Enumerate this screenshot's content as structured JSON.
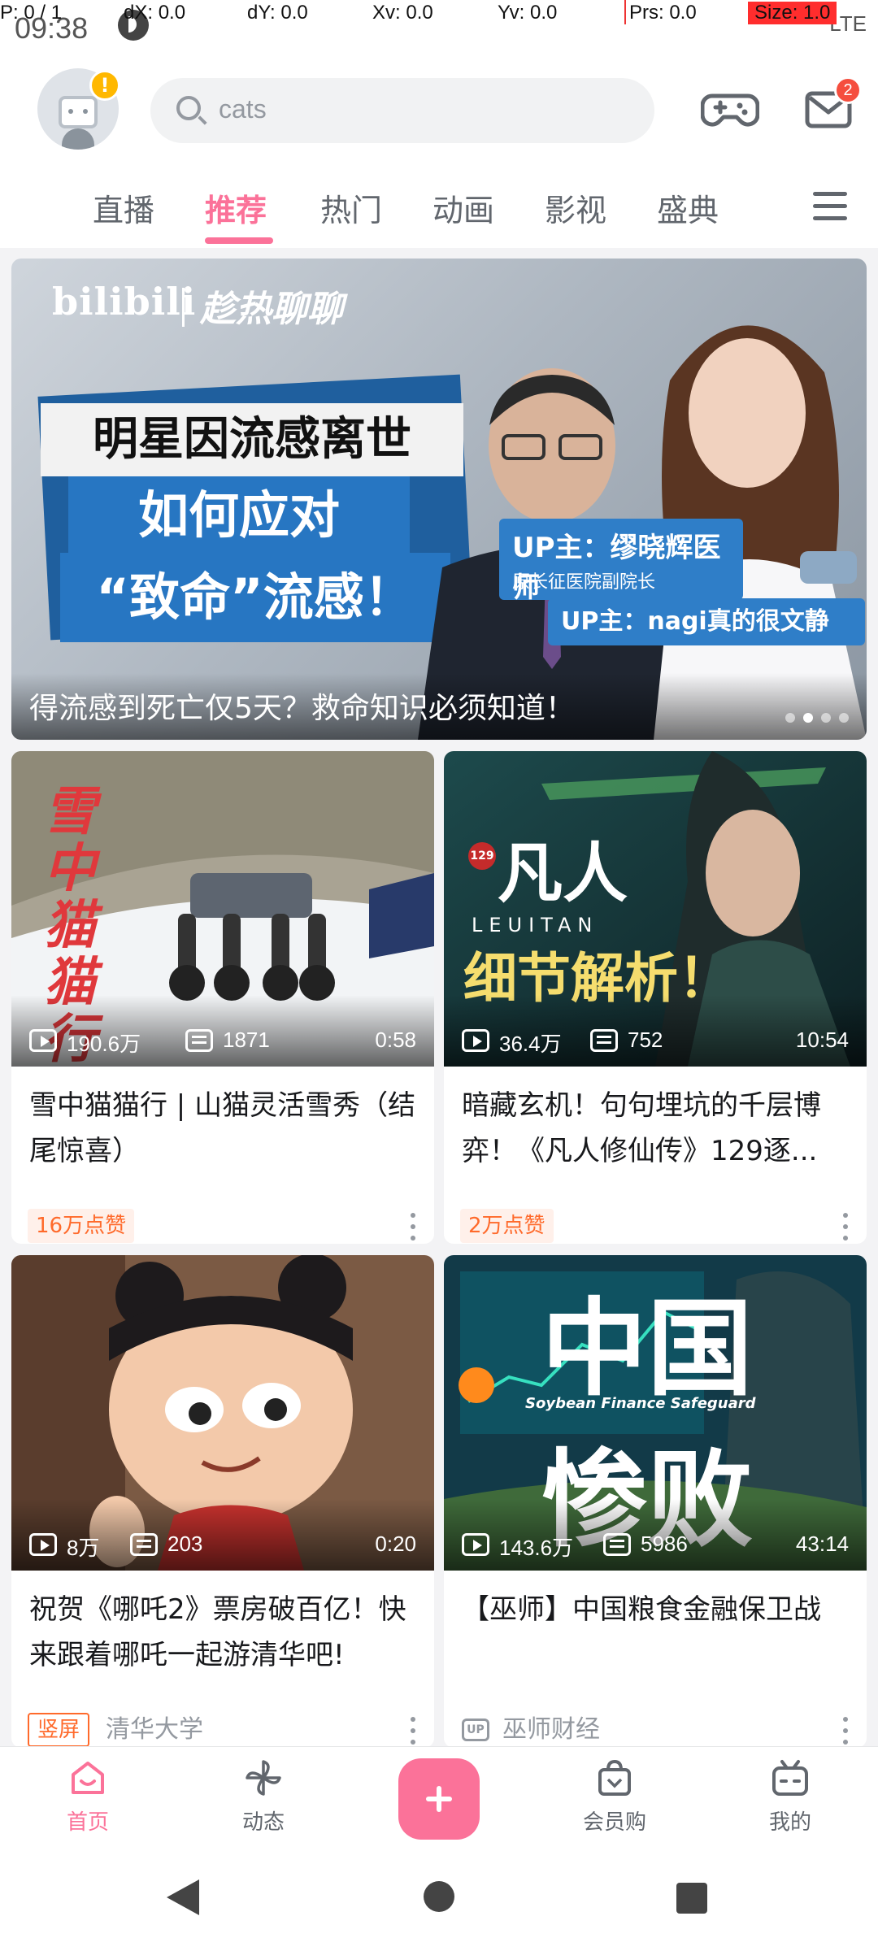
{
  "pointer_overlay": {
    "p": "P: 0 / 1",
    "dx": "dX: 0.0",
    "dy": "dY: 0.0",
    "xv": "Xv: 0.0",
    "yv": "Yv: 0.0",
    "prs": "Prs: 0.0",
    "size": "Size: 1.0"
  },
  "status_bar": {
    "time": "09:38",
    "network": "LTE"
  },
  "header": {
    "avatar_badge": "!",
    "search_placeholder": "cats",
    "messages_badge": "2"
  },
  "tabs": [
    {
      "label": "直播",
      "active": false
    },
    {
      "label": "推荐",
      "active": true
    },
    {
      "label": "热门",
      "active": false
    },
    {
      "label": "动画",
      "active": false
    },
    {
      "label": "影视",
      "active": false
    },
    {
      "label": "盛典",
      "active": false
    }
  ],
  "banner": {
    "logo": "bilibili",
    "tagline": "趁热聊聊",
    "headline_1": "明星因流感离世",
    "headline_2": "如何应对",
    "headline_3": "“致命”流感！",
    "up_1_name": "UP主：缪晓辉医师",
    "up_1_title": "原长征医院副院长",
    "up_2_name": "UP主：nagi真的很文静",
    "caption": "得流感到死亡仅5天？救命知识必须知道！",
    "page_count": 4,
    "active_page": 2
  },
  "cards": [
    {
      "thumb_text": "雪中猫猫行",
      "views": "190.6万",
      "danmaku": "1871",
      "duration": "0:58",
      "title": "雪中猫猫行 | 山猫灵活雪秀（结尾惊喜）",
      "badge": "16万点赞",
      "author": ""
    },
    {
      "thumb_text": "凡人",
      "thumb_sub": "LEUITAN",
      "thumb_big": "细节解析！",
      "thumb_num": "129",
      "views": "36.4万",
      "danmaku": "752",
      "duration": "10:54",
      "title": "暗藏玄机！句句埋坑的千层博弈！《凡人修仙传》129逐...",
      "badge": "2万点赞",
      "author": ""
    },
    {
      "views": "8万",
      "danmaku": "203",
      "duration": "0:20",
      "title": "祝贺《哪吒2》票房破百亿！快来跟着哪吒一起游清华吧!",
      "badge": "竖屏",
      "author": "清华大学"
    },
    {
      "thumb_text": "中国",
      "thumb_big": "惨败",
      "thumb_sub": "Soybean Finance Safeguard",
      "views": "143.6万",
      "danmaku": "5986",
      "duration": "43:14",
      "title": "【巫师】中国粮食金融保卫战",
      "up_label": "UP",
      "author": "巫师财经"
    }
  ],
  "bottom_nav": [
    {
      "label": "首页",
      "icon": "home-icon",
      "active": true
    },
    {
      "label": "动态",
      "icon": "pinwheel-icon",
      "active": false
    },
    {
      "label": "",
      "icon": "plus-icon",
      "active": false
    },
    {
      "label": "会员购",
      "icon": "shopping-bag-icon",
      "active": false
    },
    {
      "label": "我的",
      "icon": "tv-profile-icon",
      "active": false
    }
  ],
  "colors": {
    "accent": "#fb7299",
    "badge_orange": "#ff6a2b",
    "link_blue": "#2776c2"
  }
}
